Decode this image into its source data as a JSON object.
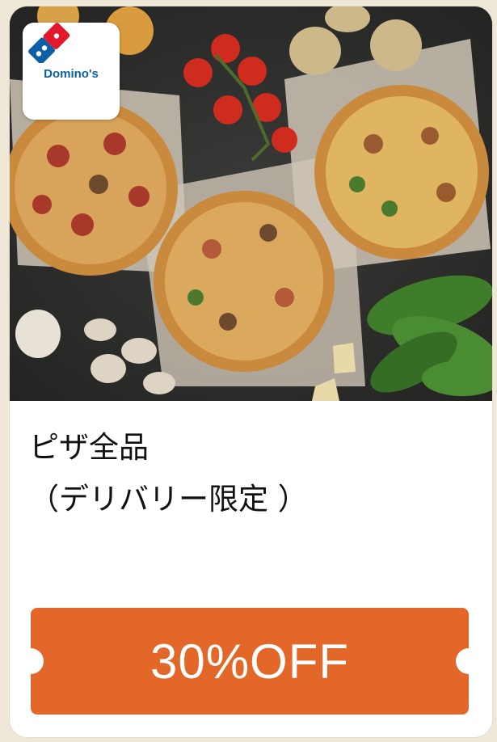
{
  "card": {
    "image_alt": "pizza-photo",
    "logo": {
      "brand_text": "Domino's"
    },
    "title_line1": "ピザ全品",
    "title_line2": "（デリバリー限定 ）",
    "coupon_label": "30%OFF"
  },
  "colors": {
    "page_bg": "#efe7d8",
    "ticket": "#e26728",
    "logo_blue": "#0b5fa5",
    "logo_red": "#e3182d"
  }
}
